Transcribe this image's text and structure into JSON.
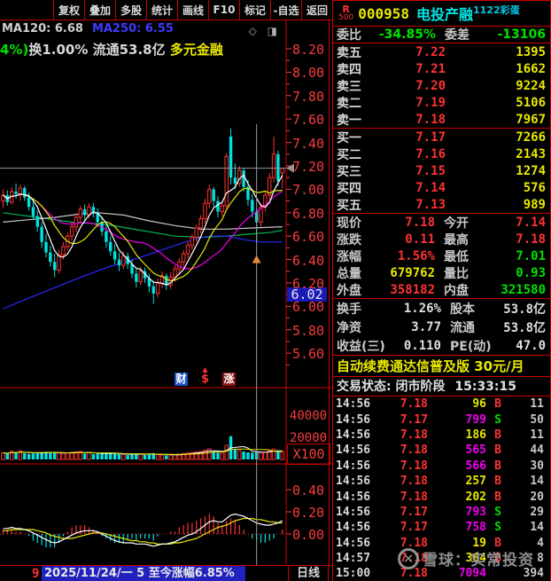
{
  "toolbar": {
    "buttons": [
      "复权",
      "叠加",
      "多股",
      "统计",
      "画线",
      "F10",
      "标记",
      "-自选",
      "返回"
    ]
  },
  "chart_header": {
    "ma120_label": "MA120: 6.68",
    "ma250_label": "MA250: 6.55",
    "info_green": "4%)",
    "info_white": "换1.00% 流通53.8亿 ",
    "info_yellow": "多元金融",
    "icons": "◇ ◨"
  },
  "price_axis": {
    "labels": [
      "8.20",
      "8.00",
      "7.80",
      "7.60",
      "7.40",
      "7.20",
      "7.00",
      "6.80",
      "6.60",
      "6.40",
      "6.20",
      "6.00",
      "5.80",
      "5.60"
    ],
    "low_highlight": "6.02"
  },
  "volume_axis": {
    "labels": [
      "40000",
      "20000"
    ],
    "unit": "X100"
  },
  "macd_axis": {
    "labels": [
      "0.40",
      "0.20",
      "0.00"
    ]
  },
  "badges": {
    "cai": "财",
    "dollar": "$",
    "zhang": "涨"
  },
  "bottom_bar": {
    "prefix": "9",
    "date_info": "2025/11/24/一 5 至今涨幅6.85%",
    "period": "日线"
  },
  "quote_panel": {
    "header": {
      "tag_top": "R",
      "tag_bottom": "500",
      "code": "000958",
      "name": "电投产融",
      "superscript": "1122彩蛋"
    },
    "weibi": {
      "label1": "委比",
      "value1": "-34.85%",
      "label2": "委差",
      "value2": "-13106"
    },
    "asks": [
      {
        "label": "卖五",
        "price": "7.22",
        "vol": "1395"
      },
      {
        "label": "卖四",
        "price": "7.21",
        "vol": "1662"
      },
      {
        "label": "卖三",
        "price": "7.20",
        "vol": "9224"
      },
      {
        "label": "卖二",
        "price": "7.19",
        "vol": "5106"
      },
      {
        "label": "卖一",
        "price": "7.18",
        "vol": "7967"
      }
    ],
    "bids": [
      {
        "label": "买一",
        "price": "7.17",
        "vol": "7266"
      },
      {
        "label": "买二",
        "price": "7.16",
        "vol": "2143"
      },
      {
        "label": "买三",
        "price": "7.15",
        "vol": "1274"
      },
      {
        "label": "买四",
        "price": "7.14",
        "vol": "576"
      },
      {
        "label": "买五",
        "price": "7.13",
        "vol": "989"
      }
    ],
    "stats": [
      [
        {
          "l": "现价",
          "v": "7.18",
          "c": "red"
        },
        {
          "l": "今开",
          "v": "7.14",
          "c": "red"
        }
      ],
      [
        {
          "l": "涨跌",
          "v": "0.11",
          "c": "red"
        },
        {
          "l": "最高",
          "v": "7.18",
          "c": "red"
        }
      ],
      [
        {
          "l": "涨幅",
          "v": "1.56%",
          "c": "red"
        },
        {
          "l": "最低",
          "v": "7.01",
          "c": "green"
        }
      ],
      [
        {
          "l": "总量",
          "v": "679762",
          "c": "yellow"
        },
        {
          "l": "量比",
          "v": "0.93",
          "c": "green"
        }
      ],
      [
        {
          "l": "外盘",
          "v": "358182",
          "c": "red"
        },
        {
          "l": "内盘",
          "v": "321580",
          "c": "green"
        }
      ]
    ],
    "fundamentals": [
      [
        {
          "l": "换手",
          "v": "1.26%",
          "c": "white"
        },
        {
          "l": "股本",
          "v": "53.8亿",
          "c": "white"
        }
      ],
      [
        {
          "l": "净资",
          "v": "3.77",
          "c": "white"
        },
        {
          "l": "流通",
          "v": "53.8亿",
          "c": "white"
        }
      ],
      [
        {
          "l": "收益(三)",
          "v": "0.110",
          "c": "white"
        },
        {
          "l": "PE(动)",
          "v": "47.0",
          "c": "white"
        }
      ]
    ],
    "banner": "自动续费通达信普及版  30元/月",
    "status": {
      "label": "交易状态:",
      "value": "闭市阶段",
      "time": "15:33:15"
    },
    "ticks": [
      {
        "t": "14:56",
        "p": "7.18",
        "v": "96",
        "vc": "yellow",
        "s": "B",
        "n": "11"
      },
      {
        "t": "14:56",
        "p": "7.17",
        "v": "799",
        "vc": "magenta",
        "s": "S",
        "n": "50"
      },
      {
        "t": "14:56",
        "p": "7.18",
        "v": "186",
        "vc": "yellow",
        "s": "B",
        "n": "11"
      },
      {
        "t": "14:56",
        "p": "7.18",
        "v": "565",
        "vc": "magenta",
        "s": "B",
        "n": "44"
      },
      {
        "t": "14:56",
        "p": "7.18",
        "v": "566",
        "vc": "magenta",
        "s": "B",
        "n": "30"
      },
      {
        "t": "14:56",
        "p": "7.18",
        "v": "257",
        "vc": "yellow",
        "s": "B",
        "n": "14"
      },
      {
        "t": "14:56",
        "p": "7.18",
        "v": "202",
        "vc": "yellow",
        "s": "B",
        "n": "20"
      },
      {
        "t": "14:56",
        "p": "7.17",
        "v": "793",
        "vc": "magenta",
        "s": "S",
        "n": "29"
      },
      {
        "t": "14:56",
        "p": "7.17",
        "v": "758",
        "vc": "magenta",
        "s": "S",
        "n": "14"
      },
      {
        "t": "14:56",
        "p": "7.18",
        "v": "19",
        "vc": "yellow",
        "s": "B",
        "n": "4"
      },
      {
        "t": "14:57",
        "p": "7.18",
        "v": "364",
        "vc": "yellow",
        "s": "B",
        "n": "8"
      },
      {
        "t": "15:00",
        "p": "7.18",
        "v": "7094",
        "vc": "magenta",
        "s": "",
        "n": "394"
      }
    ]
  },
  "watermark": {
    "logo": "✕",
    "text": "雪球：实常投资"
  },
  "chart_data": {
    "type": "candlestick",
    "title": "000958 电投产融 日线",
    "price_range": [
      5.5,
      8.3
    ],
    "last_price": 7.18,
    "cross_index": 59,
    "marker": {
      "index": 59,
      "price": 6.4,
      "color": "#e08a3c"
    },
    "candles": [
      [
        6.9,
        7.0,
        6.84,
        6.95,
        6000
      ],
      [
        6.95,
        6.99,
        6.86,
        6.89,
        5200
      ],
      [
        6.89,
        7.02,
        6.87,
        6.98,
        7400
      ],
      [
        6.98,
        7.05,
        6.92,
        6.96,
        6800
      ],
      [
        6.96,
        7.04,
        6.9,
        7.01,
        7800
      ],
      [
        7.01,
        7.03,
        6.9,
        6.93,
        5600
      ],
      [
        6.93,
        6.97,
        6.82,
        6.85,
        5000
      ],
      [
        6.85,
        6.9,
        6.74,
        6.77,
        5400
      ],
      [
        6.77,
        6.82,
        6.64,
        6.68,
        6200
      ],
      [
        6.68,
        6.72,
        6.5,
        6.55,
        6600
      ],
      [
        6.55,
        6.62,
        6.42,
        6.46,
        7000
      ],
      [
        6.46,
        6.52,
        6.34,
        6.38,
        6400
      ],
      [
        6.38,
        6.45,
        6.25,
        6.31,
        6000
      ],
      [
        6.31,
        6.48,
        6.28,
        6.44,
        5800
      ],
      [
        6.44,
        6.55,
        6.4,
        6.51,
        5600
      ],
      [
        6.51,
        6.63,
        6.48,
        6.6,
        6000
      ],
      [
        6.6,
        6.72,
        6.56,
        6.68,
        6400
      ],
      [
        6.68,
        6.79,
        6.63,
        6.76,
        6800
      ],
      [
        6.76,
        6.86,
        6.71,
        6.83,
        7200
      ],
      [
        6.83,
        6.87,
        6.73,
        6.78,
        5400
      ],
      [
        6.78,
        6.88,
        6.75,
        6.85,
        6200
      ],
      [
        6.85,
        6.88,
        6.76,
        6.8,
        4800
      ],
      [
        6.8,
        6.84,
        6.68,
        6.72,
        5200
      ],
      [
        6.72,
        6.77,
        6.6,
        6.64,
        5600
      ],
      [
        6.64,
        6.69,
        6.5,
        6.55,
        6000
      ],
      [
        6.55,
        6.6,
        6.43,
        6.47,
        5600
      ],
      [
        6.47,
        6.53,
        6.36,
        6.4,
        5200
      ],
      [
        6.4,
        6.46,
        6.3,
        6.35,
        4800
      ],
      [
        6.35,
        6.47,
        6.32,
        6.43,
        4400
      ],
      [
        6.43,
        6.46,
        6.32,
        6.36,
        4000
      ],
      [
        6.36,
        6.4,
        6.24,
        6.28,
        5200
      ],
      [
        6.28,
        6.33,
        6.16,
        6.21,
        5600
      ],
      [
        6.21,
        6.34,
        6.18,
        6.3,
        4800
      ],
      [
        6.3,
        6.33,
        6.2,
        6.24,
        4000
      ],
      [
        6.24,
        6.28,
        6.12,
        6.17,
        4800
      ],
      [
        6.17,
        6.22,
        6.02,
        6.11,
        5600
      ],
      [
        6.11,
        6.24,
        6.08,
        6.2,
        4400
      ],
      [
        6.2,
        6.3,
        6.16,
        6.26,
        4200
      ],
      [
        6.26,
        6.28,
        6.14,
        6.18,
        3800
      ],
      [
        6.18,
        6.29,
        6.15,
        6.25,
        4000
      ],
      [
        6.25,
        6.35,
        6.21,
        6.32,
        4400
      ],
      [
        6.32,
        6.41,
        6.28,
        6.38,
        4800
      ],
      [
        6.38,
        6.48,
        6.34,
        6.45,
        5400
      ],
      [
        6.45,
        6.55,
        6.41,
        6.52,
        5800
      ],
      [
        6.52,
        6.62,
        6.48,
        6.59,
        6200
      ],
      [
        6.59,
        6.7,
        6.55,
        6.67,
        6600
      ],
      [
        6.67,
        6.78,
        6.62,
        6.75,
        7200
      ],
      [
        6.75,
        6.92,
        6.71,
        6.88,
        8400
      ],
      [
        6.88,
        7.04,
        6.84,
        7.0,
        9600
      ],
      [
        7.0,
        7.02,
        6.85,
        6.9,
        7000
      ],
      [
        6.9,
        6.94,
        6.76,
        6.81,
        6000
      ],
      [
        6.81,
        6.89,
        6.77,
        6.86,
        5600
      ],
      [
        6.86,
        7.31,
        6.83,
        7.28,
        12800
      ],
      [
        7.45,
        7.52,
        7.04,
        7.1,
        21000
      ],
      [
        7.1,
        7.22,
        7.0,
        7.05,
        9000
      ],
      [
        7.05,
        7.2,
        7.02,
        7.16,
        8000
      ],
      [
        7.16,
        7.18,
        6.98,
        7.02,
        7200
      ],
      [
        7.02,
        7.08,
        6.86,
        6.91,
        6400
      ],
      [
        6.91,
        6.96,
        6.76,
        6.81,
        6000
      ],
      [
        6.81,
        6.84,
        6.55,
        6.72,
        7400
      ],
      [
        6.72,
        6.88,
        6.68,
        6.85,
        6200
      ],
      [
        6.85,
        6.98,
        6.81,
        6.95,
        6600
      ],
      [
        6.95,
        7.14,
        6.91,
        7.1,
        7800
      ],
      [
        7.1,
        7.45,
        7.06,
        7.3,
        9400
      ],
      [
        7.3,
        7.33,
        7.03,
        7.07,
        8200
      ],
      [
        7.14,
        7.18,
        7.01,
        7.18,
        6798
      ]
    ],
    "trend_lines": [
      {
        "name": "ma60",
        "color": "#00b450",
        "points": [
          [
            0,
            6.8
          ],
          [
            8,
            6.76
          ],
          [
            16,
            6.72
          ],
          [
            24,
            6.7
          ],
          [
            32,
            6.65
          ],
          [
            40,
            6.6
          ],
          [
            46,
            6.59
          ],
          [
            52,
            6.6
          ],
          [
            58,
            6.62
          ],
          [
            62,
            6.63
          ],
          [
            65,
            6.65
          ]
        ]
      },
      {
        "name": "ma120",
        "color": "#c8c8c8",
        "points": [
          [
            0,
            6.72
          ],
          [
            6,
            6.74
          ],
          [
            12,
            6.76
          ],
          [
            18,
            6.79
          ],
          [
            22,
            6.8
          ],
          [
            28,
            6.78
          ],
          [
            34,
            6.73
          ],
          [
            40,
            6.69
          ],
          [
            46,
            6.66
          ],
          [
            52,
            6.66
          ],
          [
            58,
            6.67
          ],
          [
            65,
            6.68
          ]
        ]
      },
      {
        "name": "ma250",
        "color": "#2828ff",
        "points": [
          [
            0,
            5.98
          ],
          [
            8,
            6.1
          ],
          [
            16,
            6.22
          ],
          [
            24,
            6.33
          ],
          [
            32,
            6.42
          ],
          [
            40,
            6.52
          ],
          [
            44,
            6.57
          ],
          [
            48,
            6.6
          ],
          [
            52,
            6.6
          ],
          [
            56,
            6.57
          ],
          [
            60,
            6.55
          ],
          [
            65,
            6.55
          ]
        ]
      }
    ],
    "macd": {
      "dif": [
        0.05,
        0.05,
        0.06,
        0.05,
        0.05,
        0.04,
        0.03,
        0.01,
        -0.01,
        -0.03,
        -0.05,
        -0.07,
        -0.08,
        -0.07,
        -0.05,
        -0.03,
        -0.01,
        0.01,
        0.02,
        0.03,
        0.03,
        0.03,
        0.02,
        0.0,
        -0.02,
        -0.04,
        -0.06,
        -0.07,
        -0.08,
        -0.08,
        -0.08,
        -0.09,
        -0.09,
        -0.09,
        -0.1,
        -0.11,
        -0.1,
        -0.09,
        -0.09,
        -0.08,
        -0.07,
        -0.05,
        -0.03,
        -0.01,
        0.0,
        0.02,
        0.05,
        0.08,
        0.11,
        0.12,
        0.11,
        0.11,
        0.14,
        0.17,
        0.18,
        0.17,
        0.16,
        0.14,
        0.12,
        0.1,
        0.09,
        0.08,
        0.08,
        0.09,
        0.1,
        0.12
      ],
      "dea": [
        0.03,
        0.03,
        0.04,
        0.04,
        0.04,
        0.04,
        0.04,
        0.04,
        0.03,
        0.02,
        0.01,
        -0.01,
        -0.02,
        -0.03,
        -0.04,
        -0.04,
        -0.04,
        -0.03,
        -0.02,
        -0.01,
        0.0,
        0.01,
        0.01,
        0.01,
        0.0,
        -0.01,
        -0.02,
        -0.03,
        -0.04,
        -0.05,
        -0.06,
        -0.06,
        -0.07,
        -0.07,
        -0.08,
        -0.08,
        -0.09,
        -0.09,
        -0.09,
        -0.09,
        -0.08,
        -0.08,
        -0.07,
        -0.06,
        -0.05,
        -0.04,
        -0.02,
        0.0,
        0.02,
        0.04,
        0.06,
        0.07,
        0.08,
        0.1,
        0.12,
        0.13,
        0.14,
        0.14,
        0.14,
        0.13,
        0.13,
        0.12,
        0.11,
        0.11,
        0.1,
        0.1
      ]
    },
    "colors": {
      "up": "#ff3232",
      "down": "#00e1e1",
      "ma5": "#ffffff",
      "ma10": "#e8e800",
      "ma20": "#f000f0",
      "crosshair": "#9a9a9a",
      "axis": "#c80000"
    }
  }
}
